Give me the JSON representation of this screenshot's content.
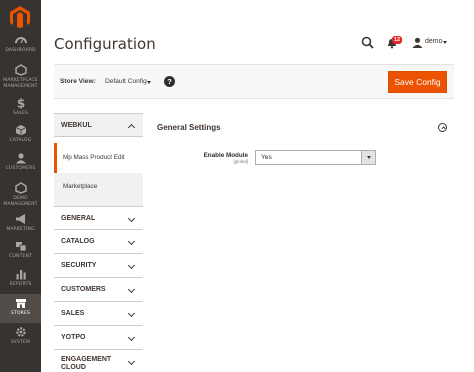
{
  "menu": [
    {
      "label": "DASHBOARD",
      "icon": "dashboard-icon"
    },
    {
      "label": "MARKETPLACE MANAGEMENT",
      "icon": "marketplace-icon"
    },
    {
      "label": "SALES",
      "icon": "dollar-icon"
    },
    {
      "label": "CATALOG",
      "icon": "cube-icon"
    },
    {
      "label": "CUSTOMERS",
      "icon": "customers-icon"
    },
    {
      "label": "DEMO MANAGEMENT",
      "icon": "hexagon-icon"
    },
    {
      "label": "MARKETING",
      "icon": "megaphone-icon"
    },
    {
      "label": "CONTENT",
      "icon": "content-icon"
    },
    {
      "label": "REPORTS",
      "icon": "bar-chart-icon"
    },
    {
      "label": "STORES",
      "icon": "store-icon",
      "active": true
    },
    {
      "label": "SYSTEM",
      "icon": "gear-icon"
    }
  ],
  "header": {
    "title": "Configuration",
    "notification_count": "12",
    "user_name": "demo"
  },
  "store_view": {
    "label": "Store View:",
    "value": "Default Config",
    "help": "?"
  },
  "save_button": "Save Config",
  "tabs": {
    "webkul": {
      "label": "WEBKUL",
      "items": [
        "Mp Mass Product Edit",
        "Marketplace"
      ]
    },
    "collapsed": [
      "GENERAL",
      "CATALOG",
      "SECURITY",
      "CUSTOMERS",
      "SALES",
      "YOTPO"
    ],
    "engagement": [
      "ENGAGEMENT",
      "CLOUD"
    ]
  },
  "section": {
    "title": "General Settings",
    "field_label": "Enable Module",
    "field_scope": "[global]",
    "field_value": "Yes"
  },
  "colors": {
    "accent": "#eb5202",
    "menu_bg": "#373330",
    "notification": "#e22626"
  }
}
